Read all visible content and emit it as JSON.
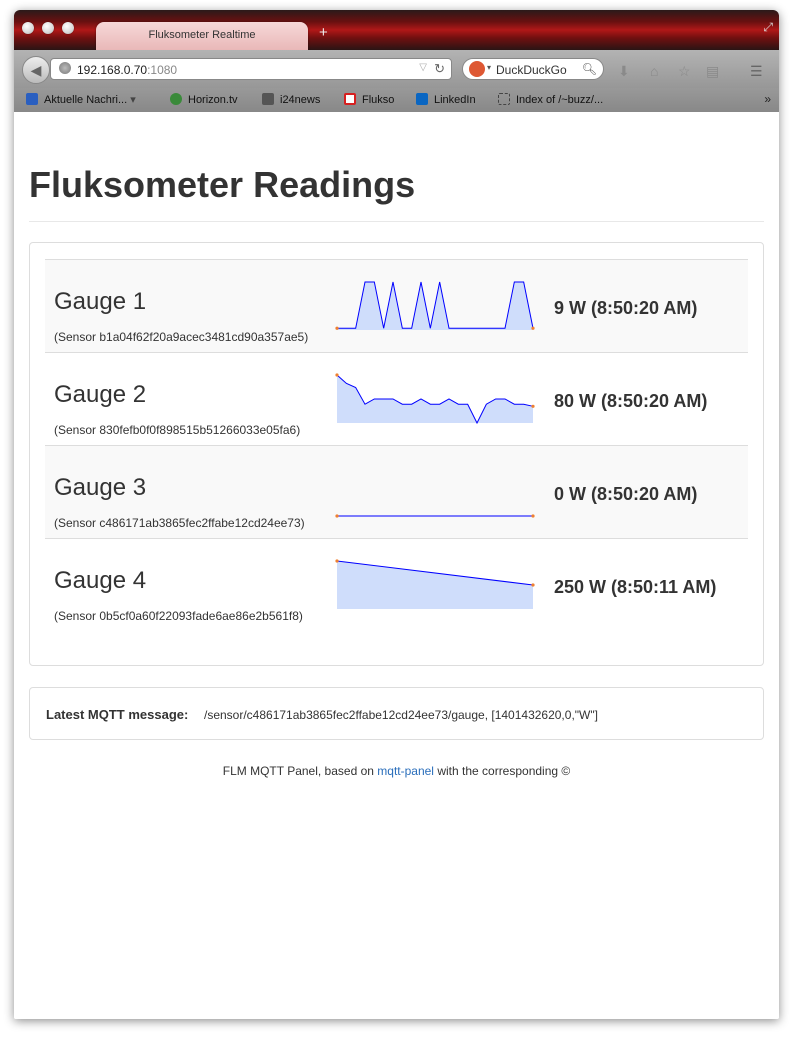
{
  "browser": {
    "tab_title": "Fluksometer Realtime",
    "new_tab": "+",
    "url_host": "192.168.0.70",
    "url_port": ":1080",
    "search_engine": "DuckDuckGo",
    "bookmarks": [
      "Aktuelle Nachri...",
      "Horizon.tv",
      "i24news",
      "Flukso",
      "LinkedIn",
      "Index of /~buzz/..."
    ],
    "bookmark_overflow": "»"
  },
  "page": {
    "title": "Fluksometer Readings"
  },
  "gauges": [
    {
      "name": "Gauge 1",
      "sensor": "(Sensor b1a04f62f20a9acec3481cd90a357ae5)",
      "reading": "9 W (8:50:20 AM)",
      "sparkline": [
        9,
        9,
        9,
        250,
        250,
        9,
        250,
        9,
        9,
        250,
        9,
        250,
        9,
        9,
        9,
        9,
        9,
        9,
        9,
        250,
        250,
        9
      ]
    },
    {
      "name": "Gauge 2",
      "sensor": "(Sensor 830fefb0f0f898515b51266033e05fa6)",
      "reading": "80 W (8:50:20 AM)",
      "sparkline": [
        230,
        190,
        170,
        90,
        115,
        115,
        115,
        90,
        90,
        115,
        90,
        90,
        115,
        90,
        90,
        0,
        90,
        115,
        115,
        90,
        90,
        80
      ]
    },
    {
      "name": "Gauge 3",
      "sensor": "(Sensor c486171ab3865fec2ffabe12cd24ee73)",
      "reading": "0 W (8:50:20 AM)",
      "sparkline": [
        0,
        0
      ]
    },
    {
      "name": "Gauge 4",
      "sensor": "(Sensor 0b5cf0a60f22093fade6ae86e2b561f8)",
      "reading": "250 W (8:50:11 AM)",
      "sparkline": [
        500,
        250
      ]
    }
  ],
  "mqtt": {
    "label": "Latest MQTT message:",
    "message": "/sensor/c486171ab3865fec2ffabe12cd24ee73/gauge, [1401432620,0,\"W\"]"
  },
  "footer": {
    "prefix": "FLM MQTT Panel, based on",
    "link": "mqtt-panel",
    "suffix": "with the corresponding ©"
  },
  "colors": {
    "spark_line": "#0000ff",
    "spark_fill": "#cfddfb",
    "spark_endpoint": "#f08030"
  }
}
